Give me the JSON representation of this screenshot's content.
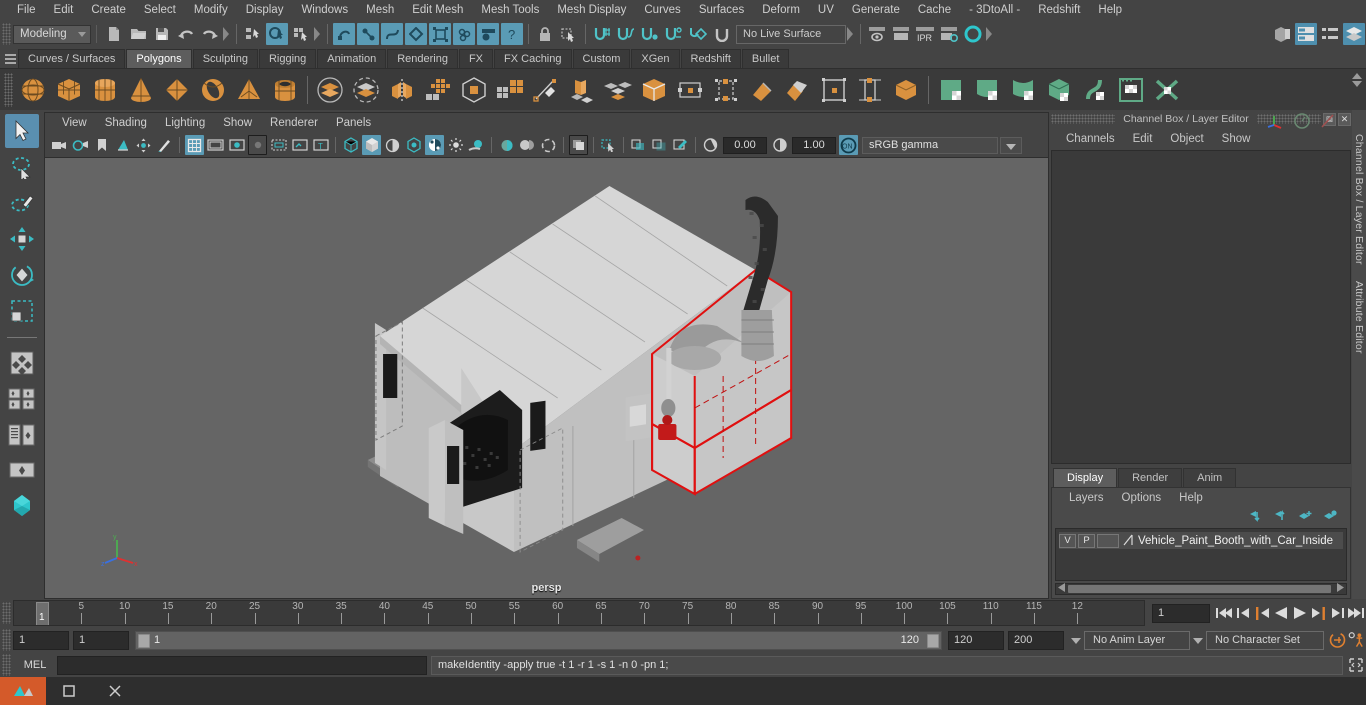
{
  "menubar": {
    "items": [
      "File",
      "Edit",
      "Create",
      "Select",
      "Modify",
      "Display",
      "Windows",
      "Mesh",
      "Edit Mesh",
      "Mesh Tools",
      "Mesh Display",
      "Curves",
      "Surfaces",
      "Deform",
      "UV",
      "Generate",
      "Cache",
      "- 3DtoAll -",
      "Redshift",
      "Help"
    ]
  },
  "statusline": {
    "menuset": "Modeling",
    "live_surface": "No Live Surface"
  },
  "shelf": {
    "tabs": [
      "Curves / Surfaces",
      "Polygons",
      "Sculpting",
      "Rigging",
      "Animation",
      "Rendering",
      "FX",
      "FX Caching",
      "Custom",
      "XGen",
      "Redshift",
      "Bullet"
    ],
    "active_tab": "Polygons"
  },
  "viewport": {
    "menus": [
      "View",
      "Shading",
      "Lighting",
      "Show",
      "Renderer",
      "Panels"
    ],
    "exposure": "0.00",
    "gamma_value": "1.00",
    "color_space": "sRGB gamma",
    "camera_label": "persp"
  },
  "channelbox": {
    "title": "Channel Box / Layer Editor",
    "menus": [
      "Channels",
      "Edit",
      "Object",
      "Show"
    ]
  },
  "layer_editor": {
    "tabs": [
      "Display",
      "Render",
      "Anim"
    ],
    "active_tab": "Display",
    "menus": [
      "Layers",
      "Options",
      "Help"
    ],
    "layers": [
      {
        "visibility": "V",
        "playback": "P",
        "color": "",
        "name": "Vehicle_Paint_Booth_with_Car_Inside"
      }
    ]
  },
  "side_tabs": [
    "Channel Box / Layer Editor",
    "Attribute Editor"
  ],
  "timeline": {
    "tick_labels": [
      "5",
      "10",
      "15",
      "20",
      "25",
      "30",
      "35",
      "40",
      "45",
      "50",
      "55",
      "60",
      "65",
      "70",
      "75",
      "80",
      "85",
      "90",
      "95",
      "100",
      "105",
      "110",
      "115",
      "12"
    ],
    "current_frame_marker": "1",
    "current_frame_field": "1"
  },
  "range": {
    "anim_start": "1",
    "range_start": "1",
    "slider_start_label": "1",
    "slider_end_label": "120",
    "range_end": "120",
    "anim_end": "200",
    "anim_layer": "No Anim Layer",
    "character_set": "No Character Set"
  },
  "command_line": {
    "mel_label": "MEL",
    "input_value": "",
    "output": "makeIdentity -apply true -t 1 -r 1 -s 1 -n 0 -pn 1;"
  },
  "colors": {
    "accent_blue": "#5a9bb5",
    "shelf_orange": "#d9913f",
    "shelf_green": "#5faa86",
    "selection_red": "#d81f1f",
    "taskbar_orange": "#d45a2a"
  },
  "icons": {
    "toolbox": [
      "select-tool-icon",
      "lasso-select-icon",
      "paint-select-icon",
      "move-tool-icon",
      "rotate-tool-icon",
      "scale-tool-icon",
      "last-tool-icon",
      "quad-view-layout-icon",
      "four-view-layout-icon",
      "outliner-persp-layout-icon",
      "persp-layout-icon",
      "hypershade-icon"
    ],
    "statusline_left": [
      "new-scene-icon",
      "open-scene-icon",
      "save-scene-icon",
      "undo-icon",
      "redo-icon",
      "select-by-hierarchy-icon",
      "select-by-object-icon",
      "select-by-component-icon",
      "mask-handle-icon",
      "mask-joint-icon",
      "mask-curve-icon",
      "mask-surface-icon",
      "mask-deformer-icon",
      "mask-dynamic-icon",
      "mask-rendering-icon",
      "mask-misc-icon",
      "lock-icon",
      "marquee-select-icon",
      "snap-grid-icon",
      "snap-curve-icon",
      "snap-point-icon",
      "snap-projected-icon",
      "snap-view-plane-icon",
      "snap-magnet-icon"
    ],
    "statusline_right": [
      "render-current-frame-icon",
      "ipr-render-icon",
      "ipr-label-icon",
      "render-settings-icon",
      "render-view-icon",
      "show-hide-attribute-editor-icon",
      "show-hide-tool-settings-icon",
      "show-hide-channel-box-icon",
      "layer-editor-icon"
    ],
    "viewport_tools": [
      "select-camera-icon",
      "camera-attributes-icon",
      "bookmark-icon",
      "image-plane-icon",
      "two-d-pan-zoom-icon",
      "grease-pencil-icon",
      "grid-icon",
      "film-gate-icon",
      "resolution-gate-icon",
      "gate-mask-icon",
      "field-chart-icon",
      "safe-action-icon",
      "safe-title-icon",
      "wireframe-icon",
      "smooth-shade-icon",
      "shaded-wireframe-icon",
      "textured-icon",
      "use-default-lighting-icon",
      "shadows-icon",
      "screen-space-ao-icon",
      "motion-blur-icon",
      "multisample-icon",
      "xray-icon",
      "xray-joints-icon",
      "isolate-select-icon",
      "exposure-icon",
      "gamma-icon",
      "color-management-icon"
    ],
    "shelf_polygons": [
      "poly-sphere-icon",
      "poly-cube-icon",
      "poly-cylinder-icon",
      "poly-cone-icon",
      "poly-plane-icon",
      "poly-torus-icon",
      "poly-pyramid-icon",
      "poly-pipe-icon",
      "combine-icon",
      "separate-icon",
      "mirror-icon",
      "smooth-icon",
      "booleans-icon",
      "extrude-icon",
      "bevel-icon",
      "bridge-icon",
      "merge-icon",
      "multi-cut-icon",
      "target-weld-icon",
      "quad-draw-icon",
      "sculpt-icon",
      "uv-editor-icon",
      "uv-planar-icon",
      "uv-cylindrical-icon",
      "uv-spherical-icon",
      "uv-automatic-icon",
      "uv-snapshot-icon",
      "uv-layout-icon"
    ],
    "playback": [
      "go-to-start-icon",
      "step-back-key-icon",
      "step-back-frame-icon",
      "play-backwards-icon",
      "play-forwards-icon",
      "step-forward-frame-icon",
      "step-forward-key-icon",
      "go-to-end-icon"
    ],
    "layer_editor": [
      "move-layer-up-icon",
      "move-layer-down-icon",
      "new-layer-icon",
      "new-layer-from-selected-icon"
    ],
    "taskbar": [
      "maya-app-icon",
      "window-restore-icon",
      "window-close-icon"
    ]
  }
}
